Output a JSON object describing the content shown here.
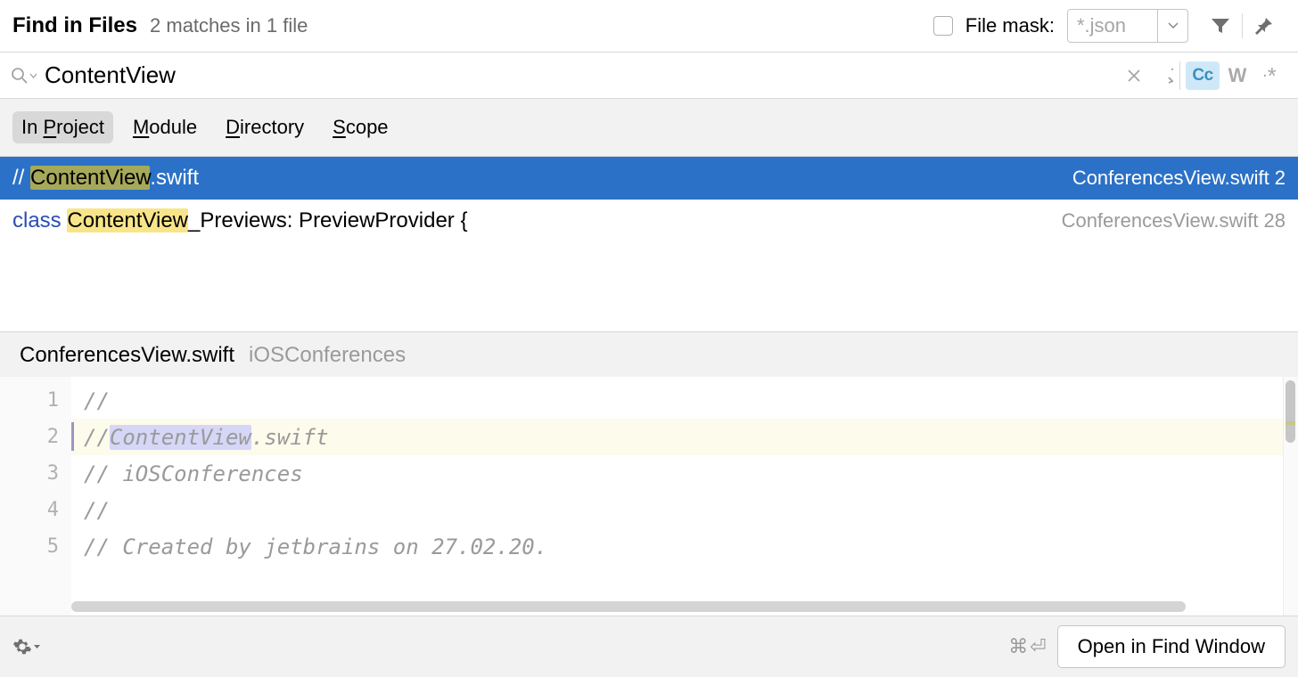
{
  "header": {
    "title": "Find in Files",
    "subtitle": "2 matches in 1 file",
    "file_mask_label": "File mask:",
    "file_mask_value": "*.json"
  },
  "search": {
    "query": "ContentView",
    "cc_label": "Cc",
    "w_label": "W",
    "star_label": ".*"
  },
  "scopes": {
    "items": [
      {
        "prefix": "In ",
        "letter": "P",
        "rest": "roject"
      },
      {
        "prefix": "",
        "letter": "M",
        "rest": "odule"
      },
      {
        "prefix": "",
        "letter": "D",
        "rest": "irectory"
      },
      {
        "prefix": "",
        "letter": "S",
        "rest": "cope"
      }
    ]
  },
  "results": [
    {
      "selected": true,
      "left_prefix": "//  ",
      "match": "ContentView",
      "left_suffix": ".swift",
      "file": "ConferencesView.swift",
      "line": "2"
    },
    {
      "selected": false,
      "kw": "class",
      "sp": " ",
      "match": "ContentView",
      "left_suffix": "_Previews: PreviewProvider {",
      "file": "ConferencesView.swift",
      "line": "28"
    }
  ],
  "preview": {
    "filename": "ConferencesView.swift",
    "module": "iOSConferences",
    "gutter": [
      "1",
      "2",
      "3",
      "4",
      "5"
    ],
    "lines": {
      "l1": "//",
      "l2_pre": "//  ",
      "l2_match": "ContentView",
      "l2_post": ".swift",
      "l3": "//  iOSConferences",
      "l4": "//",
      "l5": "//  Created by jetbrains on 27.02.20."
    }
  },
  "footer": {
    "shortcut_cmd": "⌘",
    "shortcut_enter": "⏎",
    "open_label": "Open in Find Window"
  }
}
